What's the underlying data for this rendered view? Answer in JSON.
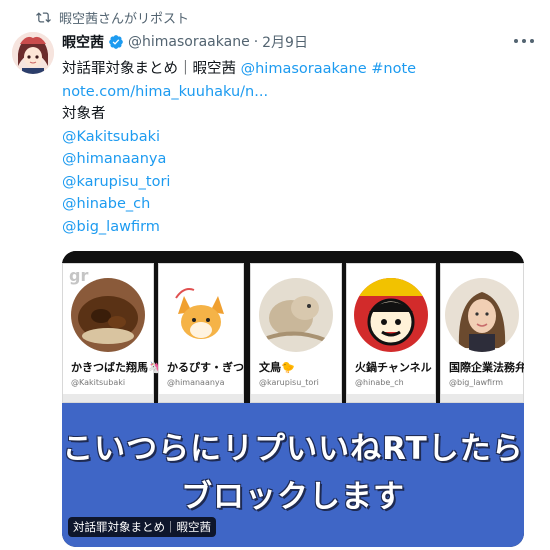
{
  "repost": {
    "text": "暇空茜さんがリポスト",
    "icon": "repost-icon"
  },
  "tweet": {
    "author_name": "暇空茜",
    "verified_icon": "verified-badge-icon",
    "handle": "@himasoraakane",
    "separator": "·",
    "date": "2月9日",
    "more_icon": "more-options-icon",
    "title_text": "対話罪対象まとめ｜暇空茜 ",
    "title_mention": "@himasoraakane",
    "title_hashtag": "#note",
    "link": "note.com/hima_kuuhaku/n...",
    "targets_label": "対象者",
    "mentions": [
      "@Kakitsubaki",
      "@himanaanya",
      "@karupisu_tori",
      "@hinabe_ch",
      "@big_lawfirm"
    ]
  },
  "media": {
    "cards": [
      {
        "name": "かきつばた翔馬🦄",
        "handle": "@Kakitsubaki",
        "watermark": "gr"
      },
      {
        "name": "かるぴす・ぎつね",
        "handle": "@himanaanya",
        "watermark": ""
      },
      {
        "name": "文鳥🐤",
        "handle": "@karupisu_tori",
        "watermark": ""
      },
      {
        "name": "火鍋チャンネル",
        "handle": "@hinabe_ch",
        "watermark": ""
      },
      {
        "name": "国際企業法務弁護",
        "handle": "@big_lawfirm",
        "watermark": ""
      }
    ],
    "banner_line1": "こいつらにリプいいねRTしたら",
    "banner_line2": "ブロックします",
    "caption": "対話罪対象まとめ｜暇空茜"
  },
  "colors": {
    "link": "#1d9bf0",
    "secondary": "#536471",
    "verified": "#1d9bf0",
    "banner": "#3f66c6"
  }
}
